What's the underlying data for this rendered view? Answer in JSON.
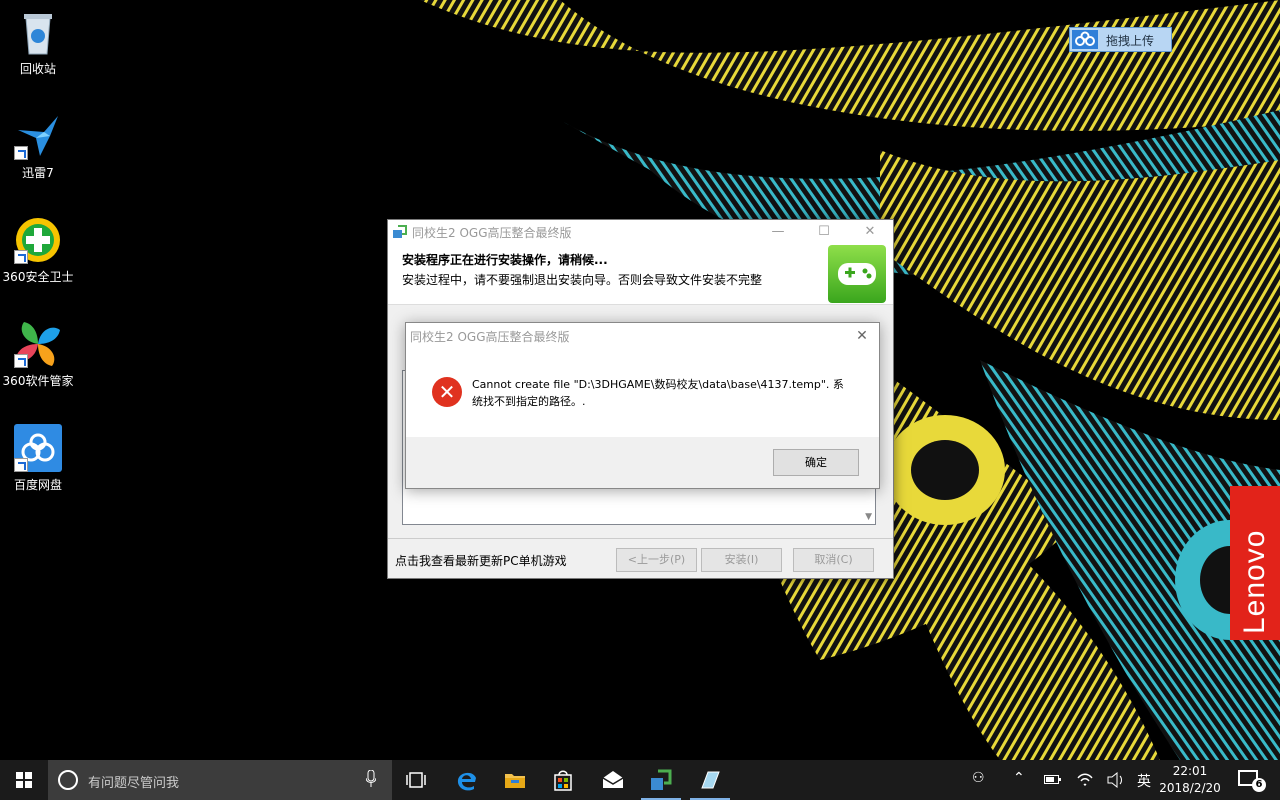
{
  "desktop": {
    "icons": [
      {
        "label": "回收站"
      },
      {
        "label": "迅雷7"
      },
      {
        "label": "360安全卫士"
      },
      {
        "label": "360软件管家"
      },
      {
        "label": "百度网盘"
      }
    ],
    "baidu_float_label": "拖拽上传",
    "brand_label": "Lenovo"
  },
  "installer": {
    "title": "同校生2 OGG高压整合最终版",
    "heading": "安装程序正在进行安装操作，请稍候...",
    "subheading": "安装过程中，请不要强制退出安装向导。否则会导致文件安装不完整",
    "link_text": "点击我查看最新更新PC单机游戏",
    "buttons": {
      "back": "<上一步(P)",
      "install": "安装(I)",
      "cancel": "取消(C)"
    }
  },
  "error_dialog": {
    "title": "同校生2 OGG高压整合最终版",
    "message": "Cannot create file \"D:\\3DHGAME\\数码校友\\data\\base\\4137.temp\". 系统找不到指定的路径。.",
    "ok_label": "确定"
  },
  "taskbar": {
    "search_placeholder": "有问题尽管问我",
    "ime_label": "英",
    "time": "22:01",
    "date": "2018/2/20",
    "notification_count": "6"
  },
  "colors": {
    "taskbar": "#1b1b1b",
    "error_red": "#e0321f",
    "lenovo_red": "#e2231a",
    "accent": "#2f7fd8"
  }
}
